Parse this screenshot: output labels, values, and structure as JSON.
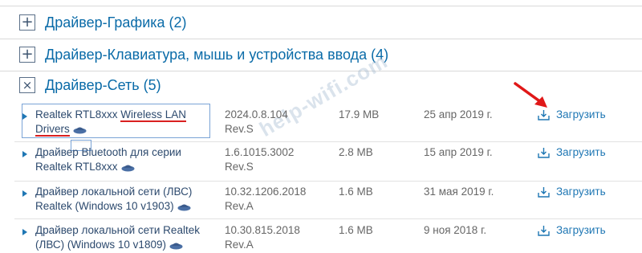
{
  "categories": [
    {
      "toggle": "+",
      "label": "Драйвер-Графика (2)"
    },
    {
      "toggle": "+",
      "label": "Драйвер-Клавиатура, мышь и устройства ввода (4)"
    },
    {
      "toggle": "×",
      "label": "Драйвер-Сеть (5)"
    }
  ],
  "drivers": [
    {
      "name_line1_a": "Realtek RTL8xxx ",
      "name_line1_b": "Wireless LAN",
      "name_line2": "Drivers",
      "version": "2024.0.8.104 Rev.S",
      "size": "17.9 MB",
      "date": "25 апр 2019 г.",
      "download": "Загрузить"
    },
    {
      "name_line1": "Драйвер Bluetooth для серии",
      "name_line2": "Realtek RTL8xxx",
      "version_line1": "1.6.1015.3002",
      "version_line2": "Rev.S",
      "size": "2.8 MB",
      "date": "15 апр 2019 г.",
      "download": "Загрузить"
    },
    {
      "name_line1": "Драйвер локальной сети (ЛВС)",
      "name_line2": "Realtek (Windows 10 v1903)",
      "version_line1": "10.32.1206.2018",
      "version_line2": "Rev.A",
      "size": "1.6 MB",
      "date": "31 мая 2019 г.",
      "download": "Загрузить"
    },
    {
      "name_line1": "Драйвер локальной сети Realtek",
      "name_line2": "(ЛВС) (Windows 10 v1809)",
      "version_line1": "10.30.815.2018",
      "version_line2": "Rev.A",
      "size": "1.6 MB",
      "date": "9 ноя 2018 г.",
      "download": "Загрузить"
    }
  ],
  "watermark": "help-wifi.com",
  "colors": {
    "link": "#1f77b4",
    "category": "#0a6ba8",
    "annotation_red": "#d92020"
  },
  "icons": {
    "expand": "plus-square-icon",
    "collapse": "x-square-icon",
    "download": "download-tray-icon",
    "detail": "cap-info-icon"
  }
}
